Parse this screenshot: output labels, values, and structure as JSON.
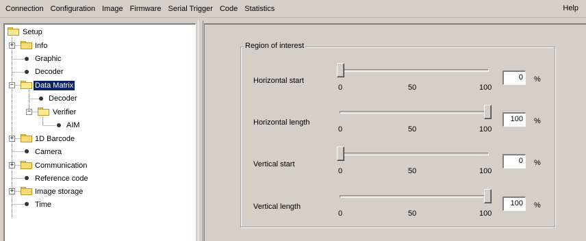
{
  "menu": {
    "items": [
      "Connection",
      "Configuration",
      "Image",
      "Firmware",
      "Serial Trigger",
      "Code",
      "Statistics"
    ],
    "help": "Help"
  },
  "tree": {
    "nodes": [
      {
        "label": "Setup",
        "kind": "folder-open",
        "expander": ""
      },
      {
        "label": "Info",
        "kind": "folder",
        "expander": "+"
      },
      {
        "label": "Graphic",
        "kind": "leaf"
      },
      {
        "label": "Decoder",
        "kind": "leaf"
      },
      {
        "label": "Data Matrix",
        "kind": "folder-open",
        "expander": "−",
        "selected": true
      },
      {
        "label": "Decoder",
        "kind": "leaf"
      },
      {
        "label": "Verifier",
        "kind": "folder-open",
        "expander": "−"
      },
      {
        "label": "AIM",
        "kind": "leaf"
      },
      {
        "label": "1D Barcode",
        "kind": "folder",
        "expander": "+"
      },
      {
        "label": "Camera",
        "kind": "leaf"
      },
      {
        "label": "Communication",
        "kind": "folder",
        "expander": "+"
      },
      {
        "label": "Reference code",
        "kind": "leaf"
      },
      {
        "label": "Image storage",
        "kind": "folder",
        "expander": "+"
      },
      {
        "label": "Time",
        "kind": "leaf"
      }
    ]
  },
  "roi": {
    "title": "Region of interest",
    "ticks": [
      "0",
      "50",
      "100"
    ],
    "unit": "%",
    "rows": [
      {
        "label": "Horizontal start",
        "value": "0",
        "fraction": 0.0
      },
      {
        "label": "Horizontal length",
        "value": "100",
        "fraction": 1.0
      },
      {
        "label": "Vertical start",
        "value": "0",
        "fraction": 0.0
      },
      {
        "label": "Vertical length",
        "value": "100",
        "fraction": 1.0
      }
    ]
  }
}
